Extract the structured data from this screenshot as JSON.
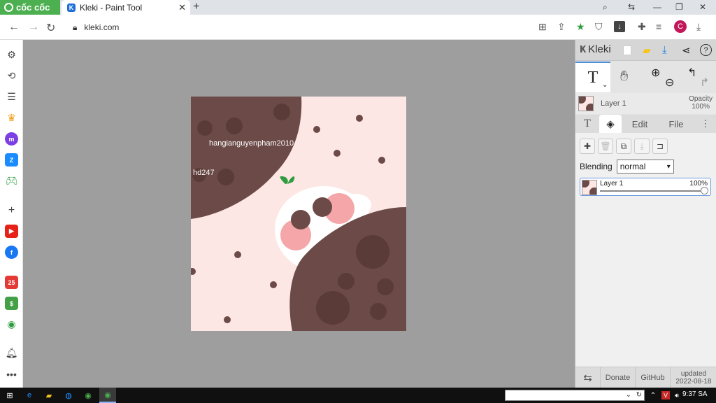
{
  "browser": {
    "brand": "cốc cốc",
    "tab_title": "Kleki - Paint Tool",
    "tab_close": "✕",
    "new_tab": "+",
    "url": "kleki.com",
    "profile_initial": "C"
  },
  "canvas": {
    "text1": "hangianguyenpham2010",
    "text2": "hd247"
  },
  "panel": {
    "app_name": "Kleki",
    "tool_label": "T",
    "layer_name_top": "Layer 1",
    "opacity_label": "Opacity",
    "opacity_value": "100%",
    "tab_text": "T",
    "tab_edit": "Edit",
    "tab_file": "File",
    "blending_label": "Blending",
    "blending_value": "normal",
    "layer_item_name": "Layer 1",
    "layer_item_opacity": "100%",
    "opacity_level": 1.0,
    "footer_donate": "Donate",
    "footer_github": "GitHub",
    "footer_updated": "updated",
    "footer_date": "2022-08-18"
  },
  "taskbar": {
    "time": "9:37 SA"
  },
  "colors": {
    "canvas_bg": "#fde7e5",
    "brown": "#6b4a47",
    "accent": "#4a90d9"
  }
}
